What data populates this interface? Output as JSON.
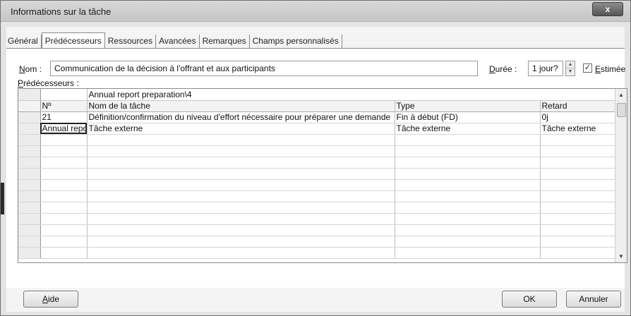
{
  "window": {
    "title": "Informations sur la tâche",
    "close_glyph": "x"
  },
  "tabs": [
    {
      "label": "Général"
    },
    {
      "label": "Prédécesseurs"
    },
    {
      "label": "Ressources"
    },
    {
      "label": "Avancées"
    },
    {
      "label": "Remarques"
    },
    {
      "label": "Champs personnalisés"
    }
  ],
  "form": {
    "name_label_u": "N",
    "name_label_rest": "om :",
    "name_value": "Communication de la décision à l'offrant et aux participants",
    "duration_label_u": "D",
    "duration_label_rest": "urée :",
    "duration_value": "1 jour?",
    "estimated_label_u": "E",
    "estimated_label_rest": "stimée",
    "estimated_checked": true,
    "predecessors_label_u": "P",
    "predecessors_label_rest": "rédécesseurs :"
  },
  "grid": {
    "project_row": "Annual report preparation\\4",
    "headers": {
      "id": "Nº",
      "task": "Nom de la tâche",
      "type": "Type",
      "lag": "Retard"
    },
    "rows": [
      {
        "id": "21",
        "task": "Définition/confirmation du niveau d'effort nécessaire pour préparer une demande",
        "type": "Fin à début (FD)",
        "lag": "0j"
      },
      {
        "id": "Annual report preparation",
        "task": "Tâche externe",
        "type": "Tâche externe",
        "lag": "Tâche externe"
      }
    ]
  },
  "buttons": {
    "help_u": "A",
    "help_rest": "ide",
    "ok": "OK",
    "cancel": "Annuler"
  },
  "icons": {
    "scroll_up": "▲",
    "scroll_down": "▼",
    "spin_up": "▲",
    "spin_down": "▼",
    "check": "✓"
  }
}
